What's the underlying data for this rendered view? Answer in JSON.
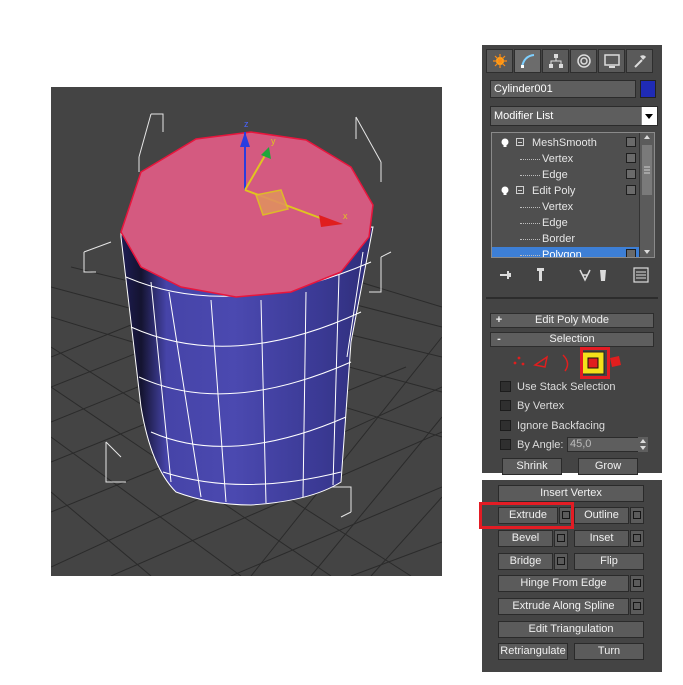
{
  "command_panel": {
    "tabs": [
      {
        "icon": "create-icon"
      },
      {
        "icon": "modify-icon"
      },
      {
        "icon": "hierarchy-icon"
      },
      {
        "icon": "motion-icon"
      },
      {
        "icon": "display-icon"
      },
      {
        "icon": "utilities-icon"
      }
    ],
    "object_name": "Cylinder001",
    "object_color": "#1f2bb5",
    "modifier_list_label": "Modifier List",
    "stack": [
      {
        "label": "MeshSmooth",
        "level": "modifier"
      },
      {
        "label": "Vertex",
        "level": "sub"
      },
      {
        "label": "Edge",
        "level": "sub"
      },
      {
        "label": "Edit Poly",
        "level": "modifier"
      },
      {
        "label": "Vertex",
        "level": "sub"
      },
      {
        "label": "Edge",
        "level": "sub"
      },
      {
        "label": "Border",
        "level": "sub"
      },
      {
        "label": "Polygon",
        "level": "sub",
        "selected": true
      }
    ],
    "edit_poly_mode_label": "Edit Poly Mode",
    "selection": {
      "title": "Selection",
      "use_stack_selection": "Use Stack Selection",
      "by_vertex": "By Vertex",
      "ignore_backfacing": "Ignore Backfacing",
      "by_angle": "By Angle:",
      "angle_value": "45,0",
      "shrink": "Shrink",
      "grow": "Grow"
    }
  },
  "edit_polygons": {
    "insert_vertex": "Insert Vertex",
    "extrude": "Extrude",
    "outline": "Outline",
    "bevel": "Bevel",
    "inset": "Inset",
    "bridge": "Bridge",
    "flip": "Flip",
    "hinge_from_edge": "Hinge From Edge",
    "extrude_along_spline": "Extrude Along Spline",
    "edit_triangulation": "Edit Triangulation",
    "retriangulate": "Retriangulate",
    "turn": "Turn"
  },
  "viewport": {
    "axis_x": "x",
    "axis_y": "y",
    "axis_z": "z"
  },
  "colors": {
    "highlight": "#e31c24",
    "polygon_selected": "#d45a80",
    "cylinder_body": "#3b3a9c",
    "selection_blue": "#3d7fd6"
  }
}
